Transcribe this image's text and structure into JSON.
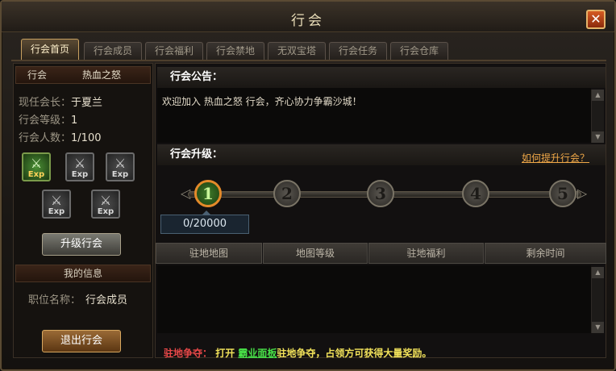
{
  "window": {
    "title": "行会",
    "close_label": "✕"
  },
  "tabs": [
    {
      "label": "行会首页",
      "active": true
    },
    {
      "label": "行会成员"
    },
    {
      "label": "行会福利"
    },
    {
      "label": "行会禁地"
    },
    {
      "label": "无双宝塔"
    },
    {
      "label": "行会任务"
    },
    {
      "label": "行会仓库"
    }
  ],
  "left": {
    "guild_key": "行会",
    "guild_name": "热血之怒",
    "leader_key": "现任会长：",
    "leader_value": "于夏兰",
    "level_key": "行会等级：",
    "level_value": "1",
    "count_key": "行会人数：",
    "count_value": "1/100",
    "skill_label": "Exp",
    "upgrade_button": "升级行会",
    "myinfo_header": "我的信息",
    "position_key": "职位名称：",
    "position_value": "行会成员",
    "quit_button": "退出行会"
  },
  "right": {
    "notice_title": "行会公告：",
    "notice_text": "欢迎加入 热血之怒 行会，齐心协力争霸沙城！",
    "upgrade_title": "行会升级：",
    "upgrade_link": "如何提升行会？",
    "nodes": [
      "1",
      "2",
      "3",
      "4",
      "5"
    ],
    "current_node": "1",
    "progress_text": "0/20000",
    "progress_value": 0,
    "progress_max": 20000,
    "columns": [
      "驻地地图",
      "地图等级",
      "驻地福利",
      "剩余时间"
    ],
    "tip_prefix": "驻地争夺：",
    "tip_open": "打开",
    "tip_link": "霸业面板",
    "tip_suffix": "驻地争夺，占领方可获得大量奖励。"
  },
  "colors": {
    "accent_orange": "#e48a2a",
    "tip_red": "#e84848",
    "tip_green": "#48e048",
    "tip_yellow": "#f2e25a",
    "link_orange": "#f0a848"
  }
}
